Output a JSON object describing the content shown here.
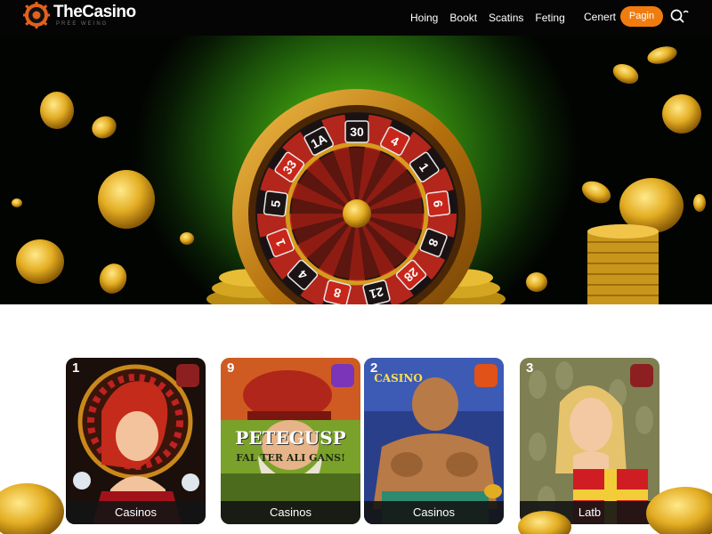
{
  "brand": {
    "name": "TheCasino",
    "tagline": "PREE WEING"
  },
  "nav": {
    "items": [
      "Hoing",
      "Bookt",
      "Scatins",
      "Feting"
    ]
  },
  "header": {
    "connect_label": "Cenert",
    "login_label": "Pagin"
  },
  "hero": {
    "wheel_numbers": [
      "30",
      "4",
      "1",
      "6",
      "8",
      "28",
      "21",
      "8",
      "4",
      "1",
      "5",
      "33",
      "1A"
    ]
  },
  "cards": [
    {
      "number": "1",
      "label": "Casinos",
      "badge_color": "#8c1f1f"
    },
    {
      "number": "9",
      "label": "Casinos",
      "badge_color": "#7a35b8",
      "art_title": "PETEGUSP",
      "art_subtitle": "FAL TER ALI GANS!"
    },
    {
      "number": "2",
      "label": "Casinos",
      "badge_color": "#e05218",
      "art_title": "CASINO"
    },
    {
      "number": "3",
      "label": "Latb",
      "badge_color": "#8c1f1f"
    }
  ],
  "colors": {
    "accent": "#f07c10",
    "header_bg": "#050505",
    "hero_green": "#39910e",
    "gold": "#e8b52a"
  },
  "icons": [
    "logo-chip-icon",
    "search-icon",
    "casino-wheel-icon",
    "badge-icon"
  ]
}
